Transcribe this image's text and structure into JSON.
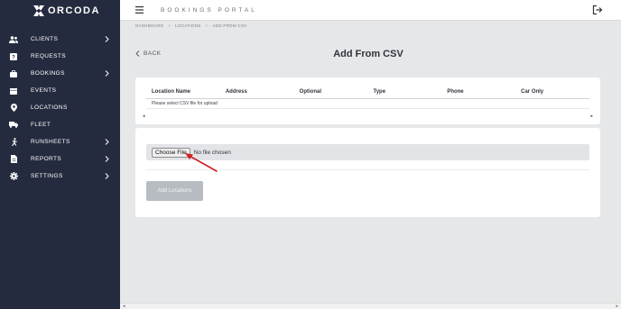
{
  "brand": {
    "name": "ORCODA"
  },
  "sidebar": {
    "items": [
      {
        "label": "CLIENTS",
        "icon": "users-icon",
        "has_submenu": true
      },
      {
        "label": "REQUESTS",
        "icon": "question-icon",
        "has_submenu": false
      },
      {
        "label": "BOOKINGS",
        "icon": "briefcase-icon",
        "has_submenu": true
      },
      {
        "label": "EVENTS",
        "icon": "calendar-icon",
        "has_submenu": false
      },
      {
        "label": "LOCATIONS",
        "icon": "map-pin-icon",
        "has_submenu": false
      },
      {
        "label": "FLEET",
        "icon": "truck-icon",
        "has_submenu": false
      },
      {
        "label": "RUNSHEETS",
        "icon": "running-icon",
        "has_submenu": true
      },
      {
        "label": "REPORTS",
        "icon": "file-icon",
        "has_submenu": true
      },
      {
        "label": "SETTINGS",
        "icon": "gear-icon",
        "has_submenu": true
      }
    ]
  },
  "topbar": {
    "title": "BOOKINGS PORTAL"
  },
  "breadcrumb": {
    "items": [
      "DASHBOARD",
      "LOCATIONS",
      "ADD FROM CSV"
    ],
    "separator": ">"
  },
  "page": {
    "back_label": "BACK",
    "title": "Add From CSV"
  },
  "table": {
    "columns": [
      "Location Name",
      "Address",
      "Optional",
      "Type",
      "Phone",
      "Car Only"
    ],
    "empty_message": "Please select CSV file for upload",
    "scroll_left": "◂",
    "scroll_right": "▸"
  },
  "upload": {
    "choose_label": "Choose File",
    "status": "No file chosen",
    "submit_label": "Add Locations",
    "submit_disabled": true
  },
  "scrollbar": {
    "left": "◂",
    "right": "▸"
  },
  "colors": {
    "sidebar_bg": "#252b3f",
    "page_bg": "#e6e7e9",
    "disabled_button": "#b6bcc1",
    "annotation_arrow": "#d11f26"
  }
}
